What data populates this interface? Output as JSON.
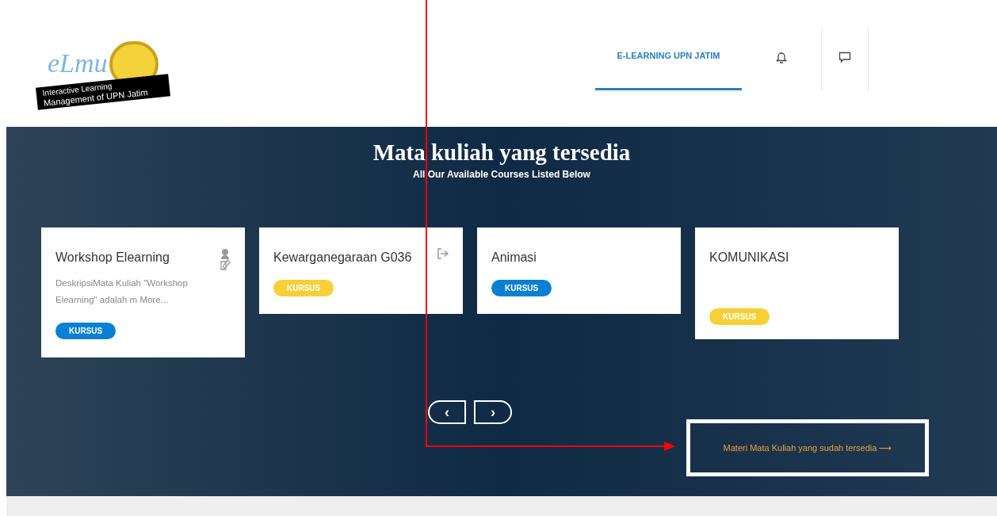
{
  "header": {
    "logo": {
      "script": "eLmu",
      "ribbon_line_1": "Interactive Learning",
      "ribbon_line_2": "Management of UPN Jatim"
    },
    "nav": [
      {
        "label": "E-LEARNING UPN JATIM",
        "selected": true
      }
    ]
  },
  "hero": {
    "title": "Mata kuliah yang tersedia",
    "subtitle": "All Our Available Courses Listed Below",
    "courses": [
      {
        "title": "Workshop Elearning",
        "kind": "teacher",
        "summary": "DeskripsiMata Kuliah \"Workshop Elearning\" adalah m",
        "more": "More...",
        "badge": "KURSUS",
        "color": "#0a7fd4"
      },
      {
        "title": "Kewarganegaraan G036",
        "kind": "enrol",
        "badge": "KURSUS",
        "color": "#f7d038"
      },
      {
        "title": "Animasi",
        "kind": "plain",
        "badge": "KURSUS",
        "color": "#0a7fd4"
      },
      {
        "title": "KOMUNIKASI",
        "kind": "tall",
        "badge": "KURSUS",
        "color": "#f7d038"
      }
    ],
    "prev": "‹",
    "next": "›",
    "link": "Materi Mata Kuliah yang sudah tersedia ⟶"
  }
}
